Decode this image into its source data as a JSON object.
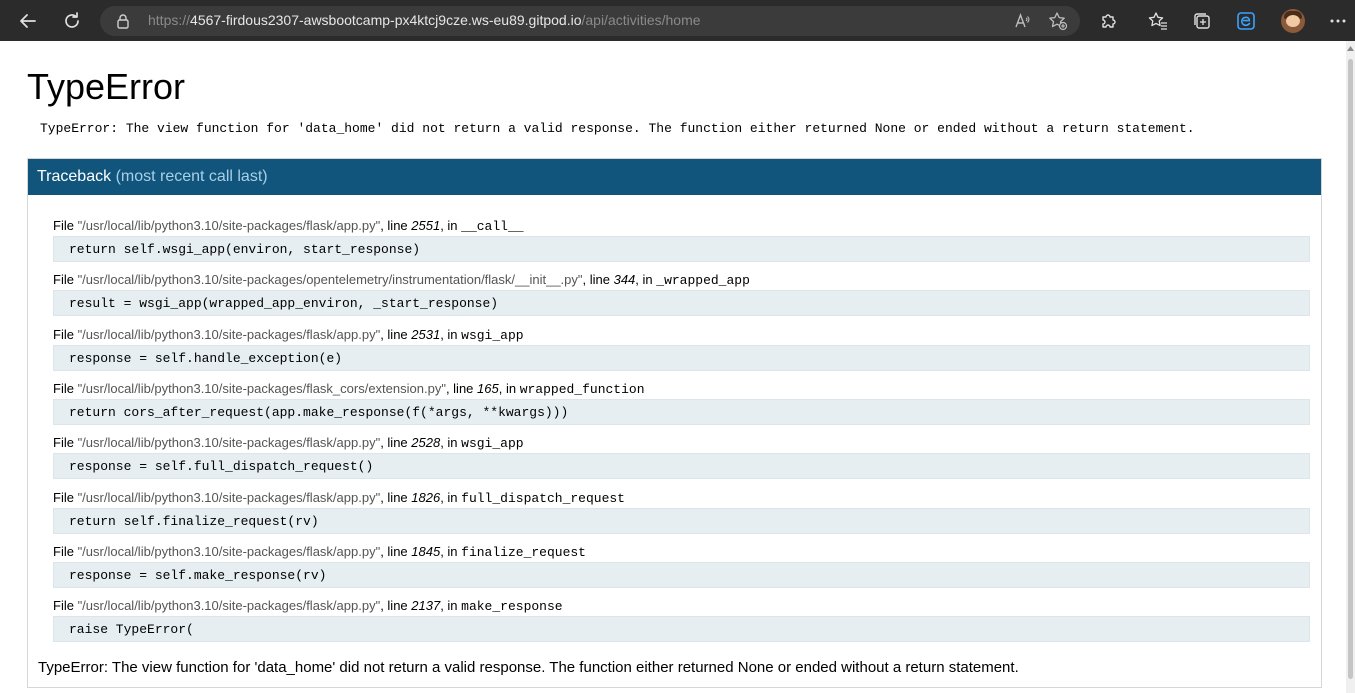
{
  "browser": {
    "url_prefix": "https://",
    "url_host": "4567-firdous2307-awsbootcamp-px4ktcj9cze.ws-eu89.gitpod.io",
    "url_path": "/api/activities/home",
    "icons": {
      "back": "back-arrow-icon",
      "refresh": "refresh-icon",
      "lock": "lock-icon",
      "read_aloud": "read-aloud-icon",
      "favorite_add": "favorite-add-icon",
      "extensions": "extensions-icon",
      "favorites": "favorites-icon",
      "collections": "collections-icon",
      "edge": "edge-icon",
      "more": "more-icon"
    }
  },
  "page": {
    "title": "TypeError",
    "error_message": "TypeError: The view function for 'data_home' did not return a valid response. The function either returned None or ended without a return statement.",
    "traceback_title": "Traceback",
    "traceback_subtitle": "(most recent call last)",
    "frames": [
      {
        "file": "\"/usr/local/lib/python3.10/site-packages/flask/app.py\"",
        "line": "2551",
        "func": "__call__",
        "code": "return self.wsgi_app(environ, start_response)"
      },
      {
        "file": "\"/usr/local/lib/python3.10/site-packages/opentelemetry/instrumentation/flask/__init__.py\"",
        "line": "344",
        "func": "_wrapped_app",
        "code": "result = wsgi_app(wrapped_app_environ, _start_response)"
      },
      {
        "file": "\"/usr/local/lib/python3.10/site-packages/flask/app.py\"",
        "line": "2531",
        "func": "wsgi_app",
        "code": "response = self.handle_exception(e)"
      },
      {
        "file": "\"/usr/local/lib/python3.10/site-packages/flask_cors/extension.py\"",
        "line": "165",
        "func": "wrapped_function",
        "code": "return cors_after_request(app.make_response(f(*args, **kwargs)))"
      },
      {
        "file": "\"/usr/local/lib/python3.10/site-packages/flask/app.py\"",
        "line": "2528",
        "func": "wsgi_app",
        "code": "response = self.full_dispatch_request()"
      },
      {
        "file": "\"/usr/local/lib/python3.10/site-packages/flask/app.py\"",
        "line": "1826",
        "func": "full_dispatch_request",
        "code": "return self.finalize_request(rv)"
      },
      {
        "file": "\"/usr/local/lib/python3.10/site-packages/flask/app.py\"",
        "line": "1845",
        "func": "finalize_request",
        "code": "response = self.make_response(rv)"
      },
      {
        "file": "\"/usr/local/lib/python3.10/site-packages/flask/app.py\"",
        "line": "2137",
        "func": "make_response",
        "code": "raise TypeError("
      }
    ],
    "labels": {
      "file": "File ",
      "line": ", line ",
      "in": ", in "
    },
    "footer_message": "TypeError: The view function for 'data_home' did not return a valid response. The function either returned None or ended without a return statement."
  },
  "colors": {
    "header_bg": "#11557c",
    "header_sub": "#a8cfe6",
    "code_bg": "#e6eef1",
    "chrome_bg": "#2b2b2b"
  }
}
